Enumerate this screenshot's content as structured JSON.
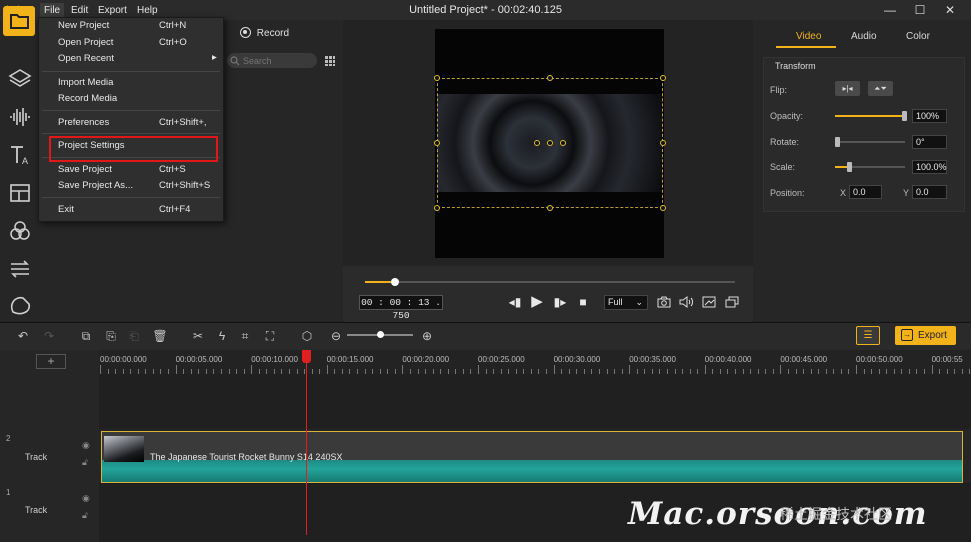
{
  "window": {
    "title": "Untitled Project* - 00:02:40.125",
    "minimize": "—",
    "maximize": "☐",
    "close": "✕"
  },
  "menubar": {
    "file": "File",
    "edit": "Edit",
    "export": "Export",
    "help": "Help"
  },
  "file_menu": {
    "items": [
      {
        "label": "New Project",
        "shortcut": "Ctrl+N"
      },
      {
        "label": "Open Project",
        "shortcut": "Ctrl+O"
      },
      {
        "label": "Open Recent",
        "shortcut": ""
      },
      {
        "label": "Import Media",
        "shortcut": ""
      },
      {
        "label": "Record Media",
        "shortcut": ""
      },
      {
        "label": "Preferences",
        "shortcut": "Ctrl+Shift+,"
      },
      {
        "label": "Project Settings",
        "shortcut": ""
      },
      {
        "label": "Save Project",
        "shortcut": "Ctrl+S"
      },
      {
        "label": "Save Project As...",
        "shortcut": "Ctrl+Shift+S"
      },
      {
        "label": "Exit",
        "shortcut": "Ctrl+F4"
      }
    ],
    "submenu_arrow": "▸"
  },
  "media": {
    "record_label": "Record",
    "search_placeholder": "Search"
  },
  "player": {
    "timecode": "00 : 00 : 13 . 750",
    "quality": "Full",
    "progress": 0.08
  },
  "properties": {
    "tabs": [
      "Video",
      "Audio",
      "Color"
    ],
    "section": "Transform",
    "flip_label": "Flip:",
    "opacity_label": "Opacity:",
    "opacity_value": "100%",
    "opacity_level": 1.0,
    "rotate_label": "Rotate:",
    "rotate_value": "0°",
    "rotate_level": 0.0,
    "scale_label": "Scale:",
    "scale_value": "100.0%",
    "scale_level": 0.2,
    "position_label": "Position:",
    "x_label": "X",
    "x_value": "0.0",
    "y_label": "Y",
    "y_value": "0.0"
  },
  "timeline": {
    "export_label": "Export",
    "add_track": "+",
    "ticks": [
      "00:00:00.000",
      "00:00:05.000",
      "00:00:10.000",
      "00:00:15.000",
      "00:00:20.000",
      "00:00:25.000",
      "00:00:30.000",
      "00:00:35.000",
      "00:00:40.000",
      "00:00:45.000",
      "00:00:50.000",
      "00:00:55"
    ],
    "tracks": [
      {
        "number": "2",
        "label": "Track",
        "clip": "The Japanese Tourist Rocket Bunny S14 240SX"
      },
      {
        "number": "1",
        "label": "Track"
      }
    ]
  },
  "watermark": {
    "text": "Mac.orsoon.com",
    "sub": "稀土掘金技术社区"
  },
  "colors": {
    "accent": "#f1b21a",
    "highlight_box": "#e01818",
    "playhead": "#e02020"
  }
}
